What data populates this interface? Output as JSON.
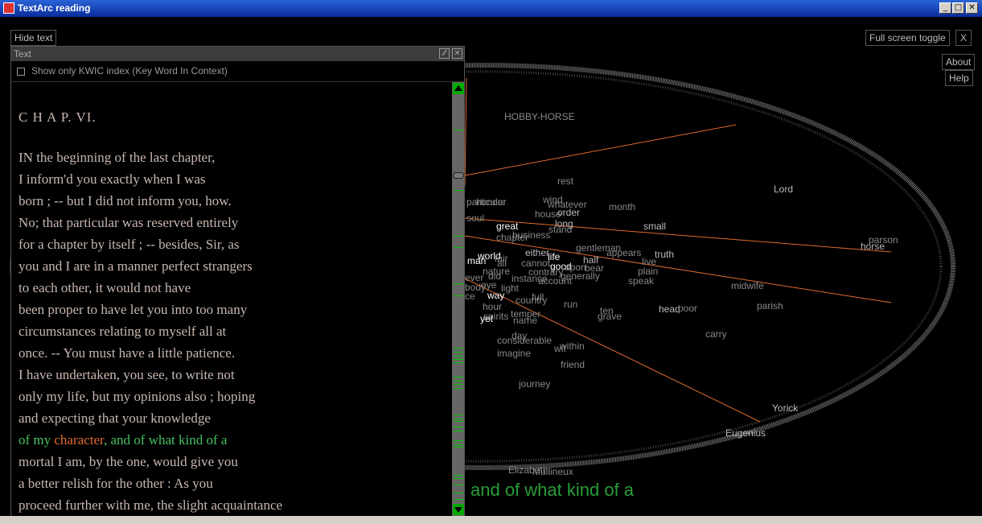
{
  "window": {
    "title": "TextArc reading"
  },
  "buttons": {
    "hide_text": "Hide text",
    "full_screen_toggle": "Full screen toggle",
    "close_x": "X",
    "about": "About",
    "help": "Help"
  },
  "panel": {
    "title": "Text",
    "kwic_label": "Show only KWIC index (Key Word In Context)",
    "kwic_checked": false,
    "chapter_heading": "C H A P. VI.",
    "lines": [
      "IN the beginning of the last chapter,",
      "I inform'd you exactly when I was",
      "born ; -- but I did not inform you, how.",
      "No; that particular was reserved entirely",
      "for a chapter by itself ; -- besides, Sir, as",
      "you and I are in a manner perfect strangers",
      "to each other, it would not have",
      "been proper to have let you into too many",
      "circumstances relating to myself all at",
      "once. -- You must have a little patience.",
      "I have undertaken, you see, to write not",
      "only my life, but my opinions also ; hoping",
      "and expecting that your knowledge"
    ],
    "highlight_line": {
      "pre": "of my ",
      "keyword": "character",
      "post": ", and of what kind of a"
    },
    "lines_after": [
      "mortal I am, by the one, would give you",
      "a better relish for the other : As you",
      "proceed further with me, the slight acquaintance"
    ]
  },
  "context_phrase": "and of what kind of a",
  "arc_words": [
    "HOBBY-HORSE",
    "rest",
    "Lord",
    "wind",
    "whatever",
    "month",
    "honour",
    "order",
    "house",
    "small",
    "soul",
    "great",
    "long",
    "stand",
    "business",
    "chapter",
    "horse",
    "parson",
    "gentleman",
    "appears",
    "truth",
    "world",
    "either",
    "life",
    "man",
    "fair",
    "cannot",
    "half",
    "live",
    "good",
    "upon",
    "bear",
    "plain",
    "nature",
    "contrary",
    "instance",
    "account",
    "generally",
    "speak",
    "midwife",
    "light",
    "eye",
    "body",
    "way",
    "country",
    "full",
    "hour",
    "run",
    "ten",
    "head",
    "poor",
    "parish",
    "spirits",
    "temper",
    "grave",
    "yet",
    "name",
    "carry",
    "day",
    "considerable",
    "within",
    "imagine",
    "friend",
    "journey",
    "Yorick",
    "Eugenius",
    "Elizabeth",
    "Mullineux",
    "particular",
    "all",
    "did",
    "wit",
    "ever",
    "ce"
  ],
  "colors": {
    "green": "#44c060",
    "orange": "#e06a2e",
    "text": "#c8b8b0",
    "context": "#2a9c3a"
  }
}
